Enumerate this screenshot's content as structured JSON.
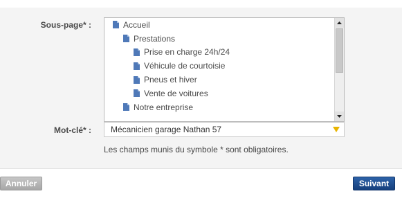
{
  "form": {
    "souspage_label": "Sous-page* :",
    "motcle_label": "Mot-clé* :",
    "tree_items": [
      {
        "label": "Accueil",
        "level": 0
      },
      {
        "label": "Prestations",
        "level": 1
      },
      {
        "label": "Prise en charge 24h/24",
        "level": 2
      },
      {
        "label": "Véhicule de courtoisie",
        "level": 2
      },
      {
        "label": "Pneus et hiver",
        "level": 2
      },
      {
        "label": "Vente de voitures",
        "level": 2
      },
      {
        "label": "Notre entreprise",
        "level": 1
      }
    ],
    "motcle_value": "Mécanicien garage Nathan 57",
    "required_note": "Les champs munis du symbole * sont obligatoires."
  },
  "buttons": {
    "cancel_label": "Annuler",
    "next_label": "Suivant"
  },
  "icons": {
    "tree_item": "document-icon",
    "dropdown": "triangle-down-icon",
    "scroll_up": "arrow-up-icon",
    "scroll_down": "arrow-down-icon"
  },
  "colors": {
    "doc_icon": "#4f79b8",
    "dropdown_arrow": "#e8b400",
    "next_button": "#1e4d8f",
    "cancel_button": "#b3b3b3"
  }
}
